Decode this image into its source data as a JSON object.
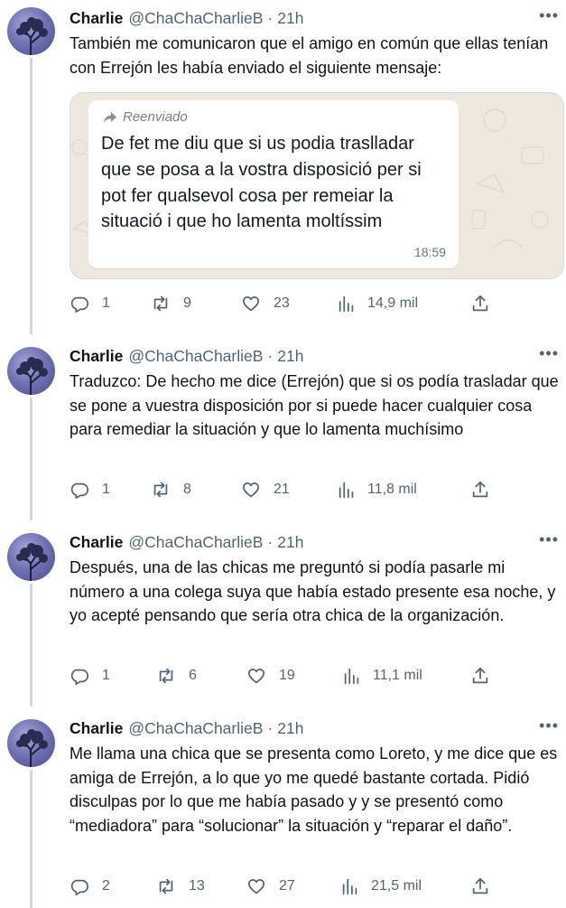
{
  "tweets": [
    {
      "name": "Charlie",
      "handle": "@ChaChaCharlieB",
      "time": "21h",
      "text": "También me comunicaron que el amigo en común que ellas tenían con Errejón les había enviado el siguiente mensaje:",
      "media": {
        "forwarded_label": "Reenviado",
        "message": "De fet me diu que si us podia traslladar que se posa a la vostra disposició per si pot fer qualsevol cosa per remeiar la situació i que ho lamenta moltíssim",
        "time": "18:59"
      },
      "replies": "1",
      "retweets": "9",
      "likes": "23",
      "views": "14,9 mil"
    },
    {
      "name": "Charlie",
      "handle": "@ChaChaCharlieB",
      "time": "21h",
      "text": "Traduzco: De hecho me dice (Errejón) que si os podía trasladar que se pone a vuestra disposición por si puede hacer cualquier cosa para remediar la situación y que lo lamenta muchísimo",
      "replies": "1",
      "retweets": "8",
      "likes": "21",
      "views": "11,8 mil"
    },
    {
      "name": "Charlie",
      "handle": "@ChaChaCharlieB",
      "time": "21h",
      "text": "Después, una de las chicas me preguntó si podía pasarle mi número a una colega suya que había estado presente esa noche, y yo acepté pensando que sería otra chica de la organización.",
      "replies": "1",
      "retweets": "6",
      "likes": "19",
      "views": "11,1 mil"
    },
    {
      "name": "Charlie",
      "handle": "@ChaChaCharlieB",
      "time": "21h",
      "text": "Me llama una chica que se presenta como Loreto, y me dice que es amiga de Errejón, a lo que yo me quedé bastante cortada. Pidió disculpas por lo que me había pasado y y se presentó como “mediadora” para “solucionar” la situación y “reparar el daño”.",
      "replies": "2",
      "retweets": "13",
      "likes": "27",
      "views": "21,5 mil"
    }
  ],
  "separator": "·",
  "icons": {
    "avatar": "tree-silhouette-avatar",
    "more": "more-dots-icon",
    "reply": "reply-bubble-icon",
    "retweet": "retweet-arrows-icon",
    "like": "heart-icon",
    "views": "bar-chart-icon",
    "share": "share-upload-icon",
    "forward": "forward-arrow-icon"
  },
  "colors": {
    "text": "#0f1419",
    "secondary": "#536471",
    "thread_line": "#cfd9de",
    "whatsapp_bg": "#efe8de",
    "bubble": "#ffffff"
  }
}
